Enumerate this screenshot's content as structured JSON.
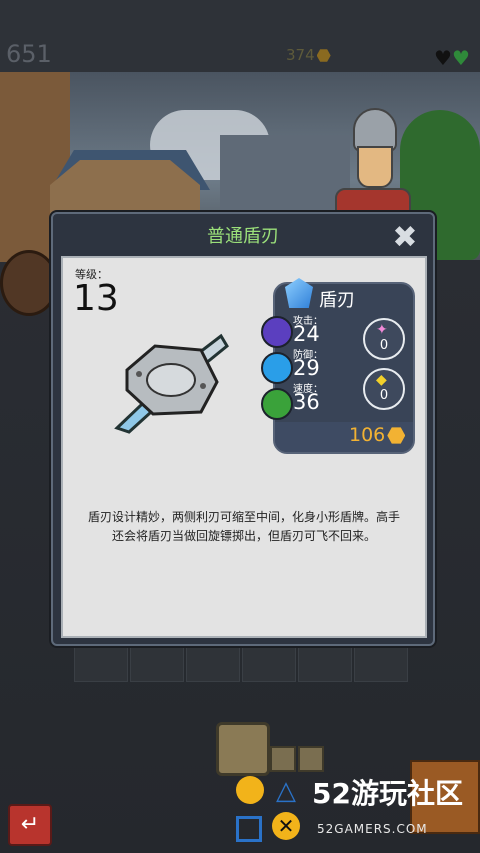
{
  "hud": {
    "score": "651",
    "gold": "374"
  },
  "modal": {
    "title": "普通盾刃",
    "close_icon": "close-x-icon"
  },
  "item": {
    "level_label": "等级：",
    "level": "13",
    "name": "盾刃",
    "image_icon": "shield-blade-icon",
    "stats": [
      {
        "label": "攻击：",
        "value": "24",
        "icon": "attack-star-icon",
        "color": "#5b3fbf"
      },
      {
        "label": "防御：",
        "value": "29",
        "icon": "defense-shield-icon",
        "color": "#2a9ee8"
      },
      {
        "label": "速度：",
        "value": "36",
        "icon": "speed-chevron-icon",
        "color": "#3aa23a"
      }
    ],
    "sockets": [
      {
        "icon": "pink-star-gem-icon",
        "count": "0"
      },
      {
        "icon": "yellow-diamond-gem-icon",
        "count": "0"
      }
    ],
    "price": "106",
    "description": "盾刃设计精妙，两侧利刃可缩至中间，化身小形盾牌。高手还会将盾刃当做回旋镖掷出，但盾刃可飞不回来。"
  },
  "watermark": {
    "title": "52游玩社区",
    "subtitle": "52GAMERS.COM"
  },
  "colors": {
    "title_green": "#9be07a",
    "price_gold": "#f2b233",
    "panel_bg": "#e3e3e3",
    "stats_bg": "#394457"
  }
}
